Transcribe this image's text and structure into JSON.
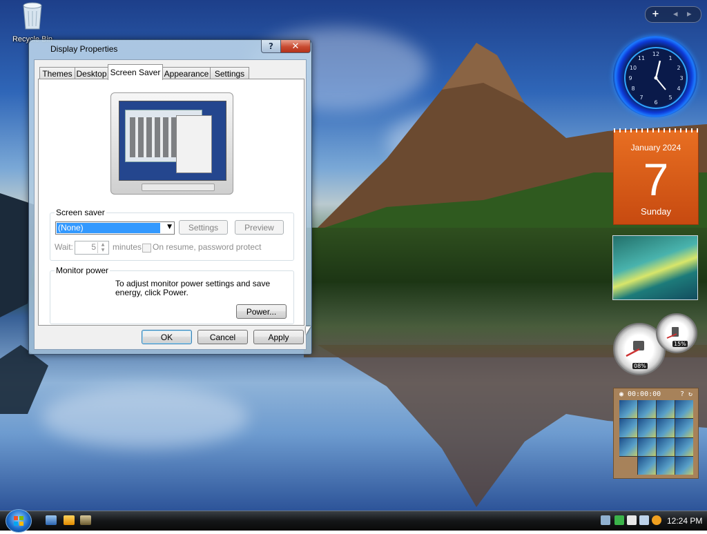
{
  "desktop": {
    "icons": [
      {
        "label": "Recycle Bin",
        "icon": "recycle-bin-icon"
      }
    ]
  },
  "dialog": {
    "title": "Display Properties",
    "help_label": "?",
    "close_label": "✕",
    "tabs": [
      {
        "label": "Themes",
        "active": false
      },
      {
        "label": "Desktop",
        "active": false
      },
      {
        "label": "Screen Saver",
        "active": true
      },
      {
        "label": "Appearance",
        "active": false
      },
      {
        "label": "Settings",
        "active": false
      }
    ],
    "screen_saver": {
      "group_label": "Screen saver",
      "selected": "(None)",
      "settings_label": "Settings",
      "preview_label": "Preview",
      "wait_label": "Wait:",
      "wait_value": "5",
      "minutes_label": "minutes",
      "resume_label": "On resume, password protect"
    },
    "monitor_power": {
      "group_label": "Monitor power",
      "description": "To adjust monitor power settings and save energy, click Power.",
      "power_label": "Power..."
    },
    "footer": {
      "ok_label": "OK",
      "cancel_label": "Cancel",
      "apply_label": "Apply"
    }
  },
  "gadgets": {
    "sidebar_controls": {
      "add": "+",
      "prev": "◂",
      "next": "▸"
    },
    "calendar": {
      "month": "January 2024",
      "day": "7",
      "weekday": "Sunday"
    },
    "cpu_meter": {
      "cpu": "08%",
      "memory": "15%"
    },
    "puzzle": {
      "timer": "00:00:00"
    }
  },
  "taskbar": {
    "quick_launch": [
      "show-desktop-icon",
      "media-player-icon",
      "switch-windows-icon"
    ],
    "tray_icons": [
      "network-icon",
      "security-icon",
      "mouse-icon",
      "volume-icon",
      "search-icon"
    ],
    "clock": "12:24 PM"
  },
  "colors": {
    "selection": "#3399ff",
    "calendar": "#e86f22",
    "clock_glow": "#2c8dff"
  }
}
